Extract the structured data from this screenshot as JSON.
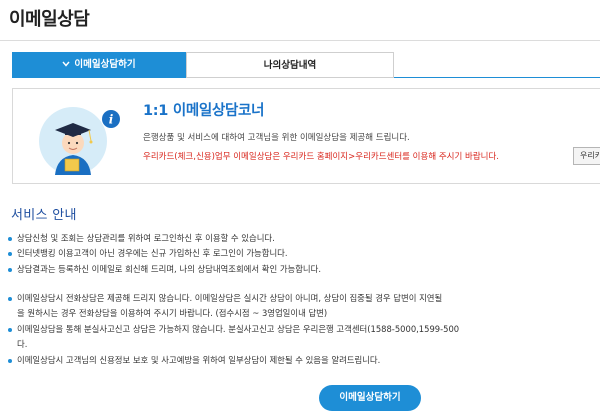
{
  "page": {
    "title": "이메일상담"
  },
  "tabs": [
    {
      "label": "이메일상담하기",
      "active": true,
      "icon": "chevron-down-icon"
    },
    {
      "label": "나의상담내역",
      "active": false
    }
  ],
  "intro": {
    "illustration_icon": "graduate-info-icon",
    "title": "1:1 이메일상담코너",
    "desc": "은행상품 및 서비스에 대하여 고객님을 위한 이메일상담을 제공해 드립니다.",
    "notice": "우리카드(체크,신용)업무 이메일상담은 우리카드 홈페이지>우리카드센터를 이용해 주시기 바랍니다.",
    "notice_button": "우리카드"
  },
  "service": {
    "title": "서비스 안내",
    "group1": [
      "상담신청 및 조회는 상담관리를 위하여 로그인하신 후 이용할 수 있습니다.",
      "인터넷뱅킹 이용고객이 아닌 경우에는 신규 가입하신 후 로그인이 가능합니다.",
      "상담결과는 등록하신 이메일로 회신해 드리며, 나의 상담내역조회에서 확인 가능합니다."
    ],
    "group2": [
      {
        "text": "이메일상담시 전화상담은 제공해 드리지 않습니다. 이메일상담은 실시간 상담이 아니며, 상담이 집중될 경우 답변이 지연될",
        "bullet": true
      },
      {
        "text": "을 원하시는 경우 전화상담을 이용하여 주시기 바랍니다. (접수시점 ~ 3영업일이내 답변)",
        "bullet": false
      },
      {
        "text": "이메일상담을 통해 분실사고신고 상담은 가능하지 않습니다. 분실사고신고 상담은 우리은행 고객센터(1588-5000,1599-500",
        "bullet": true
      },
      {
        "text": "다.",
        "bullet": false
      },
      {
        "text": "이메일상담시 고객님의 신용정보 보호 및 사고예방을 위하여 일부상담이 제한될 수 있음을 알려드립니다.",
        "bullet": true
      }
    ]
  },
  "cta": {
    "label": "이메일상담하기"
  },
  "colors": {
    "accent": "#1e8ed6",
    "title_blue": "#1a73c9",
    "notice_red": "#d9271e",
    "section_blue": "#1f4fa0"
  }
}
